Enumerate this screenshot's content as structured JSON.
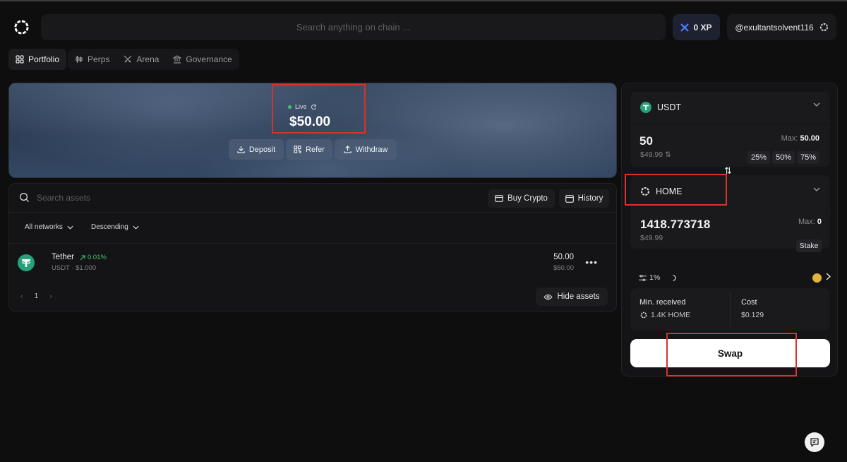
{
  "header": {
    "search_placeholder": "Search anything on chain ...",
    "xp_label": "0 XP",
    "username": "@exultantsolvent116"
  },
  "nav": {
    "tabs": [
      {
        "label": "Portfolio",
        "icon": "grid-icon",
        "active": true
      },
      {
        "label": "Perps",
        "icon": "candles-icon",
        "active": false
      },
      {
        "label": "Arena",
        "icon": "swords-icon",
        "active": false
      },
      {
        "label": "Governance",
        "icon": "bank-icon",
        "active": false
      }
    ]
  },
  "hero": {
    "status": "Live",
    "balance": "$50.00",
    "actions": [
      {
        "label": "Deposit",
        "icon": "download-icon"
      },
      {
        "label": "Refer",
        "icon": "qr-icon"
      },
      {
        "label": "Withdraw",
        "icon": "upload-icon"
      }
    ]
  },
  "assets": {
    "search_placeholder": "Search assets",
    "buy_crypto": "Buy Crypto",
    "history": "History",
    "network_filter": "All networks",
    "sort_filter": "Descending",
    "rows": [
      {
        "name": "Tether",
        "change": "0.01%",
        "symbol_price": "USDT · $1.000",
        "value": "50.00",
        "value_usd": "$50.00"
      }
    ],
    "page": "1",
    "hide_assets": "Hide assets"
  },
  "swap": {
    "from_token": "USDT",
    "from_amount": "50",
    "from_usd": "$49.99",
    "from_max_label": "Max:",
    "from_max_value": "50.00",
    "percentages": [
      "25%",
      "50%",
      "75%"
    ],
    "to_token": "HOME",
    "to_amount": "1418.773718",
    "to_usd": "$49.99",
    "to_max_label": "Max:",
    "to_max_value": "0",
    "stake": "Stake",
    "slippage": "1%",
    "min_received_label": "Min. received",
    "min_received_value": "1.4K HOME",
    "cost_label": "Cost",
    "cost_value": "$0.129",
    "swap_button": "Swap"
  },
  "colors": {
    "accent_green": "#48c774",
    "annotation_red": "#d9312b",
    "tether_green": "#26a17b"
  }
}
